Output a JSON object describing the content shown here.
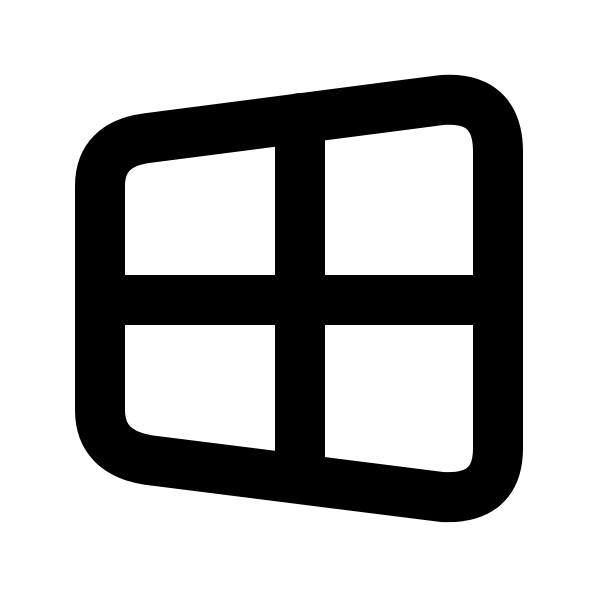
{
  "icon": {
    "name": "windows-logo-icon",
    "stroke_color": "#000000",
    "background_color": "#ffffff"
  }
}
